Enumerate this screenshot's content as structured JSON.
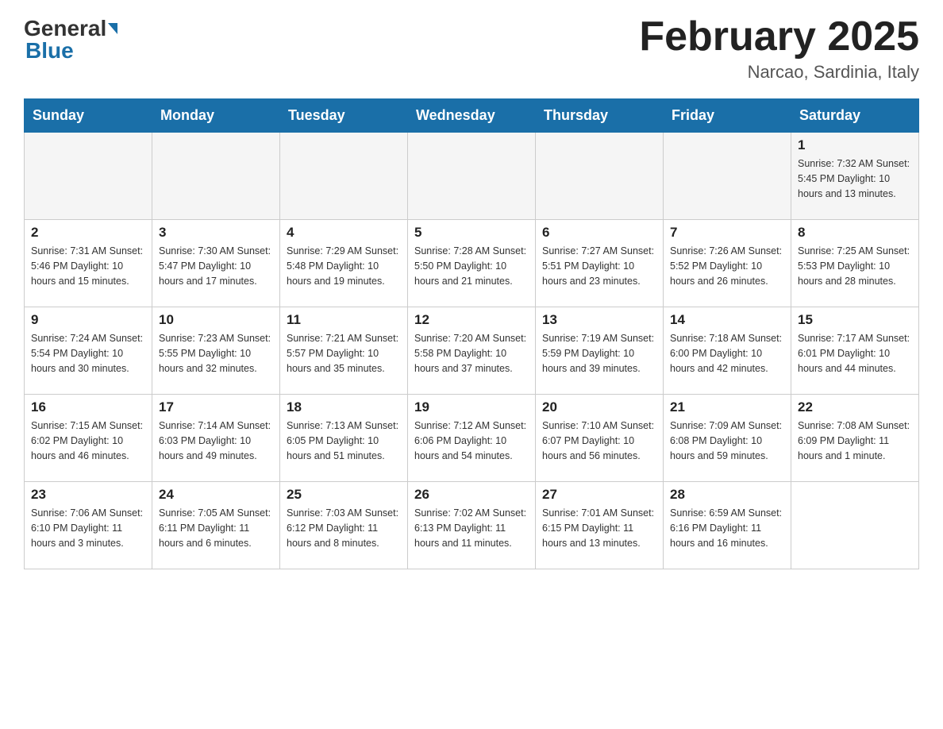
{
  "header": {
    "logo_general": "General",
    "logo_blue": "Blue",
    "month_year": "February 2025",
    "location": "Narcao, Sardinia, Italy"
  },
  "days_of_week": [
    "Sunday",
    "Monday",
    "Tuesday",
    "Wednesday",
    "Thursday",
    "Friday",
    "Saturday"
  ],
  "weeks": [
    [
      {
        "day": "",
        "info": ""
      },
      {
        "day": "",
        "info": ""
      },
      {
        "day": "",
        "info": ""
      },
      {
        "day": "",
        "info": ""
      },
      {
        "day": "",
        "info": ""
      },
      {
        "day": "",
        "info": ""
      },
      {
        "day": "1",
        "info": "Sunrise: 7:32 AM\nSunset: 5:45 PM\nDaylight: 10 hours and 13 minutes."
      }
    ],
    [
      {
        "day": "2",
        "info": "Sunrise: 7:31 AM\nSunset: 5:46 PM\nDaylight: 10 hours and 15 minutes."
      },
      {
        "day": "3",
        "info": "Sunrise: 7:30 AM\nSunset: 5:47 PM\nDaylight: 10 hours and 17 minutes."
      },
      {
        "day": "4",
        "info": "Sunrise: 7:29 AM\nSunset: 5:48 PM\nDaylight: 10 hours and 19 minutes."
      },
      {
        "day": "5",
        "info": "Sunrise: 7:28 AM\nSunset: 5:50 PM\nDaylight: 10 hours and 21 minutes."
      },
      {
        "day": "6",
        "info": "Sunrise: 7:27 AM\nSunset: 5:51 PM\nDaylight: 10 hours and 23 minutes."
      },
      {
        "day": "7",
        "info": "Sunrise: 7:26 AM\nSunset: 5:52 PM\nDaylight: 10 hours and 26 minutes."
      },
      {
        "day": "8",
        "info": "Sunrise: 7:25 AM\nSunset: 5:53 PM\nDaylight: 10 hours and 28 minutes."
      }
    ],
    [
      {
        "day": "9",
        "info": "Sunrise: 7:24 AM\nSunset: 5:54 PM\nDaylight: 10 hours and 30 minutes."
      },
      {
        "day": "10",
        "info": "Sunrise: 7:23 AM\nSunset: 5:55 PM\nDaylight: 10 hours and 32 minutes."
      },
      {
        "day": "11",
        "info": "Sunrise: 7:21 AM\nSunset: 5:57 PM\nDaylight: 10 hours and 35 minutes."
      },
      {
        "day": "12",
        "info": "Sunrise: 7:20 AM\nSunset: 5:58 PM\nDaylight: 10 hours and 37 minutes."
      },
      {
        "day": "13",
        "info": "Sunrise: 7:19 AM\nSunset: 5:59 PM\nDaylight: 10 hours and 39 minutes."
      },
      {
        "day": "14",
        "info": "Sunrise: 7:18 AM\nSunset: 6:00 PM\nDaylight: 10 hours and 42 minutes."
      },
      {
        "day": "15",
        "info": "Sunrise: 7:17 AM\nSunset: 6:01 PM\nDaylight: 10 hours and 44 minutes."
      }
    ],
    [
      {
        "day": "16",
        "info": "Sunrise: 7:15 AM\nSunset: 6:02 PM\nDaylight: 10 hours and 46 minutes."
      },
      {
        "day": "17",
        "info": "Sunrise: 7:14 AM\nSunset: 6:03 PM\nDaylight: 10 hours and 49 minutes."
      },
      {
        "day": "18",
        "info": "Sunrise: 7:13 AM\nSunset: 6:05 PM\nDaylight: 10 hours and 51 minutes."
      },
      {
        "day": "19",
        "info": "Sunrise: 7:12 AM\nSunset: 6:06 PM\nDaylight: 10 hours and 54 minutes."
      },
      {
        "day": "20",
        "info": "Sunrise: 7:10 AM\nSunset: 6:07 PM\nDaylight: 10 hours and 56 minutes."
      },
      {
        "day": "21",
        "info": "Sunrise: 7:09 AM\nSunset: 6:08 PM\nDaylight: 10 hours and 59 minutes."
      },
      {
        "day": "22",
        "info": "Sunrise: 7:08 AM\nSunset: 6:09 PM\nDaylight: 11 hours and 1 minute."
      }
    ],
    [
      {
        "day": "23",
        "info": "Sunrise: 7:06 AM\nSunset: 6:10 PM\nDaylight: 11 hours and 3 minutes."
      },
      {
        "day": "24",
        "info": "Sunrise: 7:05 AM\nSunset: 6:11 PM\nDaylight: 11 hours and 6 minutes."
      },
      {
        "day": "25",
        "info": "Sunrise: 7:03 AM\nSunset: 6:12 PM\nDaylight: 11 hours and 8 minutes."
      },
      {
        "day": "26",
        "info": "Sunrise: 7:02 AM\nSunset: 6:13 PM\nDaylight: 11 hours and 11 minutes."
      },
      {
        "day": "27",
        "info": "Sunrise: 7:01 AM\nSunset: 6:15 PM\nDaylight: 11 hours and 13 minutes."
      },
      {
        "day": "28",
        "info": "Sunrise: 6:59 AM\nSunset: 6:16 PM\nDaylight: 11 hours and 16 minutes."
      },
      {
        "day": "",
        "info": ""
      }
    ]
  ]
}
